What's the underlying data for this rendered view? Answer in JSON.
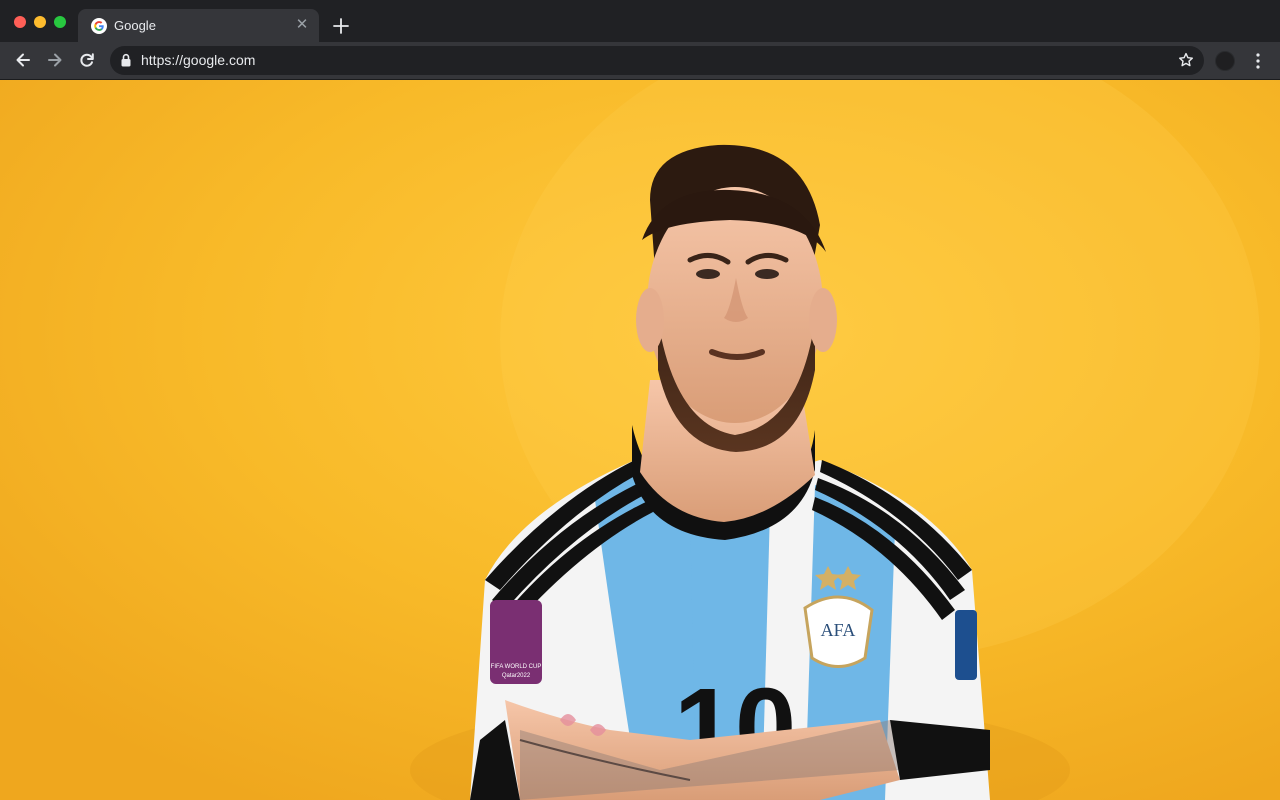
{
  "browser": {
    "tab": {
      "title": "Google",
      "favicon": "google-g-icon"
    },
    "address_bar": {
      "url": "https://google.com",
      "lock_icon": "lock-icon"
    },
    "icons": {
      "back": "arrow-left-icon",
      "forward": "arrow-right-icon",
      "reload": "reload-icon",
      "bookmark": "star-icon",
      "menu": "more-vert-icon",
      "new_tab": "plus-icon",
      "tab_close": "close-icon"
    },
    "colors": {
      "frame": "#202124",
      "toolbar": "#35363a",
      "omnibox": "#202124",
      "text": "#e8eaed",
      "traffic_close": "#ff5f57",
      "traffic_minimize": "#febc2e",
      "traffic_maximize": "#28c840"
    }
  },
  "page": {
    "background_color": "#f8ba29",
    "image": {
      "subject": "football-player-photo",
      "jersey_number": "10",
      "badge_text": "AFA",
      "patch_text": "FIFA WORLD CUP Qatar2022"
    }
  }
}
